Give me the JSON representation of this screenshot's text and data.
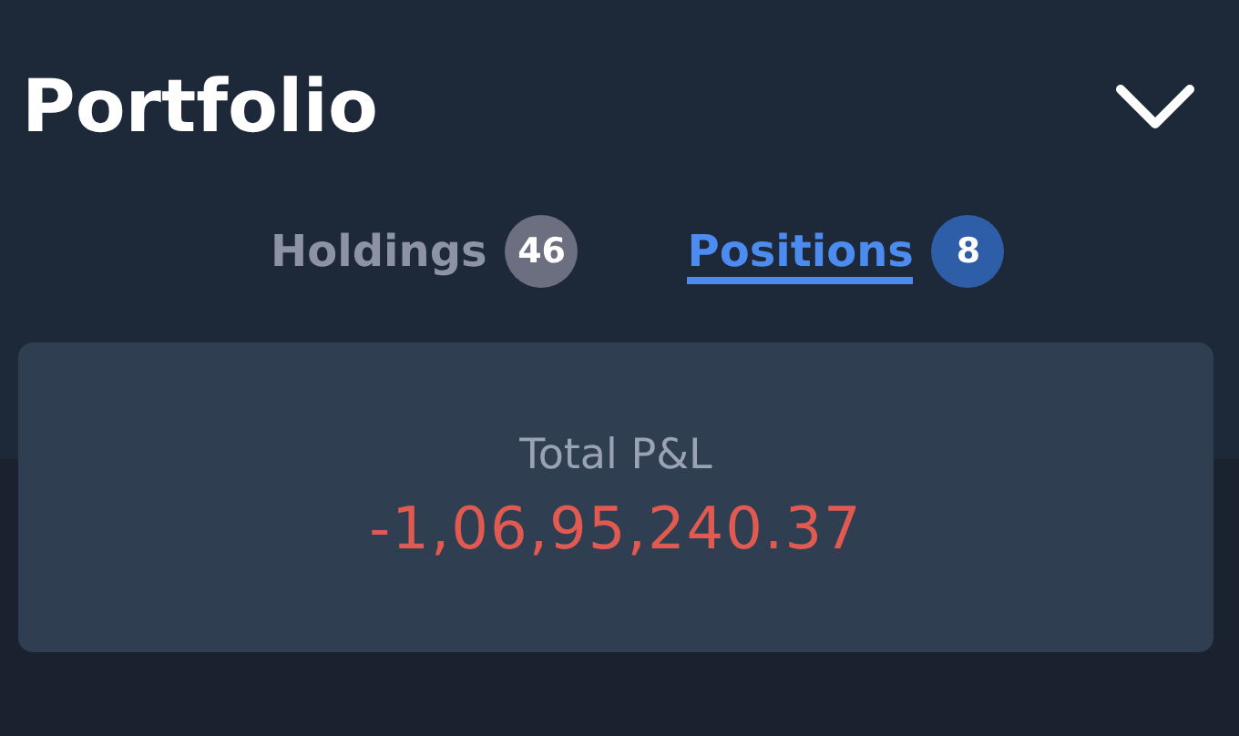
{
  "header": {
    "title": "Portfolio",
    "expanded": false
  },
  "tabs": [
    {
      "label": "Holdings",
      "count": "46",
      "selected": false
    },
    {
      "label": "Positions",
      "count": "8",
      "selected": true
    }
  ],
  "summary": {
    "label": "Total P&L",
    "value": "-1,06,95,240.37"
  }
}
